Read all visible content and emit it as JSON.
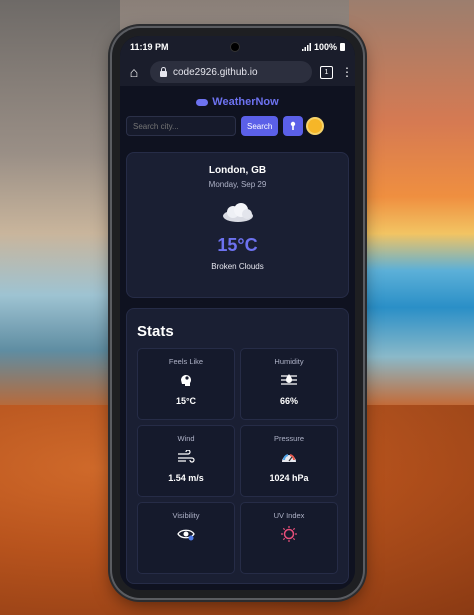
{
  "status_bar": {
    "time": "11:19 PM",
    "battery": "100%"
  },
  "browser": {
    "url": "code2926.github.io",
    "tab_count": "1"
  },
  "app": {
    "title": "WeatherNow"
  },
  "search": {
    "placeholder": "Search city...",
    "button_label": "Search"
  },
  "current": {
    "city": "London, GB",
    "date": "Monday, Sep 29",
    "temperature": "15°C",
    "description": "Broken Clouds",
    "icon": "cloud-icon"
  },
  "stats": {
    "title": "Stats",
    "items": [
      {
        "label": "Feels Like",
        "value": "15°C",
        "icon": "head-thermo-icon"
      },
      {
        "label": "Humidity",
        "value": "66%",
        "icon": "humidity-icon"
      },
      {
        "label": "Wind",
        "value": "1.54 m/s",
        "icon": "wind-icon"
      },
      {
        "label": "Pressure",
        "value": "1024 hPa",
        "icon": "gauge-icon"
      },
      {
        "label": "Visibility",
        "value": "",
        "icon": "eye-icon"
      },
      {
        "label": "UV Index",
        "value": "",
        "icon": "uv-icon"
      }
    ]
  },
  "colors": {
    "accent": "#6d72f0",
    "background": "#0f1220",
    "card": "#1a1f33",
    "sun": "#f6b628"
  }
}
